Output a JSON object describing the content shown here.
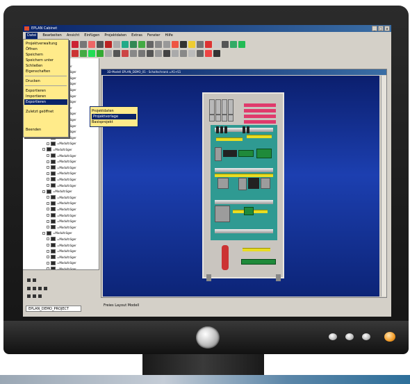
{
  "app": {
    "title": "EPLAN Cabinet",
    "window_controls": [
      "_",
      "□",
      "x"
    ]
  },
  "menubar": [
    "Datei",
    "Bearbeiten",
    "Ansicht",
    "Einfügen",
    "Projektdaten",
    "Extras",
    "Fenster",
    "Hilfe"
  ],
  "file_menu": {
    "items": [
      "Projektverwaltung",
      "Öffnen",
      "Speichern",
      "Speichern unter",
      "Schließen",
      "Eigenschaften",
      "Drucken",
      "Exportieren",
      "Importieren",
      "Exportieren",
      "Zuletzt geöffnet"
    ],
    "selected_index": 9
  },
  "submenu_1": {
    "items": [
      "Beenden"
    ]
  },
  "submenu_2": {
    "items": [
      "Projektdaten",
      "Projektvorlage",
      "Basisprojekt"
    ],
    "selected_index": 1
  },
  "tree_items": [
    "=Modulträger",
    "=Modulträger",
    "=Modulträger",
    "=Modulträger",
    "=Modulträger",
    "=Modulträger",
    "=Modulträger",
    "=Modulträger",
    "=Modulträger",
    "=Modulträger",
    "=Modulträger",
    "=Modulträger",
    "=Modulträger",
    "=Modulträger",
    "=Modulträger",
    "=Modulträger",
    "=Modulträger",
    "=Modulträger",
    "=Modulträger",
    "=Modulträger",
    "=Modulträger",
    "=Modulträger",
    "=Modulträger",
    "=Modulträger",
    "=Modulträger",
    "=Modulträger",
    "=Modulträger",
    "=Modulträger",
    "=Modulträger",
    "=Modulträger",
    "=Modulträger",
    "=Modulträger",
    "=Modulträger",
    "=Modulträger",
    "=Modulträger"
  ],
  "left_tab": "EPLAN_DEMO_PROJECT",
  "doc_window": {
    "title": "3D-Modell EPLAN_DEMO_01 - Schaltschrank =A1+S1"
  },
  "status": {
    "text": "Freies Layout Modell"
  },
  "colors": {
    "canvas_top": "#0b1f6e",
    "canvas_mid": "#1c3fb0",
    "titlebar": "#0a246a",
    "menu_bg": "#ffeb8a",
    "cabinet_panel": "#2f9a92",
    "wire": "#e03a6c",
    "terminal": "#e8dc22"
  },
  "icons": [
    "new-icon",
    "open-icon",
    "save-icon",
    "print-icon",
    "undo-icon",
    "redo-icon",
    "cut-icon",
    "copy-icon",
    "paste-icon",
    "zoom-icon",
    "delete-icon",
    "rotate-icon",
    "settings-icon"
  ]
}
